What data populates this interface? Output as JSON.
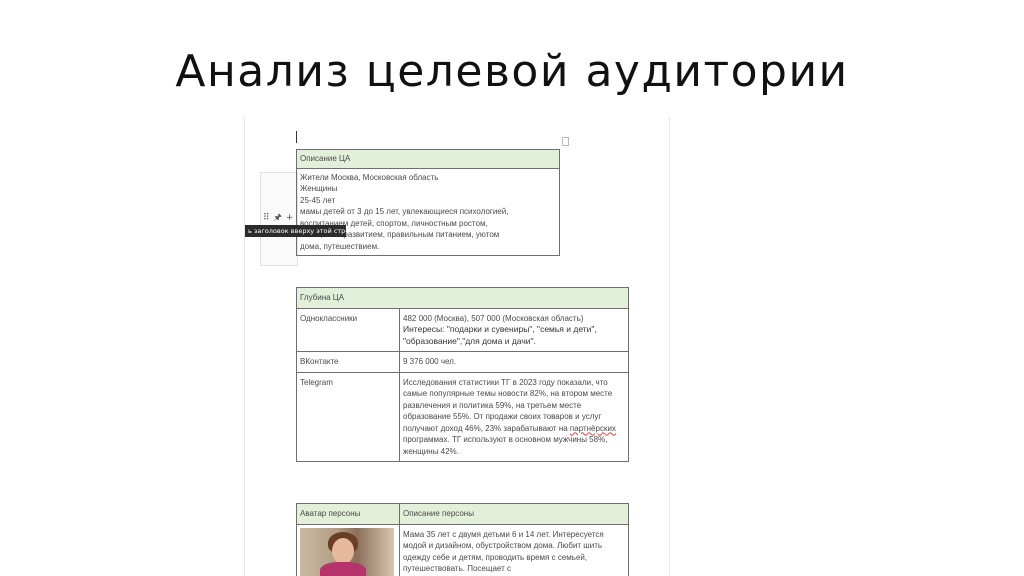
{
  "slide": {
    "title": "Анализ целевой аудитории"
  },
  "editor": {
    "tooltip": "ь заголовок вверху этой строки",
    "row_controls": {
      "grip": "⠿",
      "pin": "🖈",
      "add": "+"
    }
  },
  "table1": {
    "header": "Описание ЦА",
    "lines": [
      "Жители Москва, Московская область",
      "Женщины",
      "25-45 лет",
      "мамы детей от 3 до 15 лет, увлекающиеся психологией,",
      "воспитанием детей, спортом, личностным ростом,",
      "йогой, саморазвитием, правильным питанием,  уютом",
      "дома, путешествием."
    ]
  },
  "table2": {
    "header": "Глубина ЦА",
    "rows": [
      {
        "label": "Одноклассники",
        "value": "482 000 (Москва), 507 000 (Московская область)",
        "interests": "Интересы: \"подарки и сувениры\", \"семья и дети\", \"образование\",\"для дома и дачи\"."
      },
      {
        "label": "ВКонтакте",
        "value": "9 376 000 чел."
      },
      {
        "label": "Telegram",
        "value_before": "Исследования статистики ТГ в 2023 году показали, что самые популярные темы новости 82%, на втором месте развлечения и политика 59%, на третьем месте образование 55%. От продажи своих товаров и услуг получают доход 46%, 23% зарабатывают на ",
        "value_underlined": "партнёрских",
        "value_after": " программах. ТГ используют в основном мужчины 58%, женщины 42%."
      }
    ]
  },
  "table3": {
    "header_left": "Аватар персоны",
    "header_right": "Описание персоны",
    "description": "Мама 35 лет с двумя детьми 6 и 14 лет. Интересуется модой и дизайном, обустройством дома. Любит шить одежду себе и детям, проводить время с семьей, путешествовать. Посещает с"
  }
}
